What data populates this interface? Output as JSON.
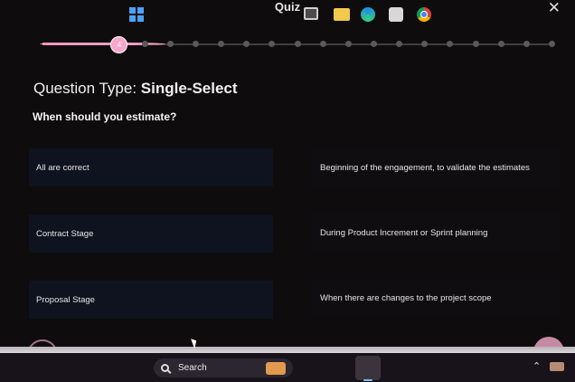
{
  "quiz": {
    "title": "Quiz",
    "close_symbol": "✕",
    "progress": {
      "current_step": 4,
      "total_steps": 21,
      "current_label": "4"
    },
    "question_type_label": "Question Type:",
    "question_type_value": "Single-Select",
    "question": "When should you estimate?",
    "options_left": [
      "All are correct",
      "Contract Stage",
      "Proposal Stage"
    ],
    "options_right": [
      "Beginning of the engagement, to validate the estimates",
      "During Product Increment or Sprint planning",
      "When there are changes to the project scope"
    ]
  },
  "taskbar": {
    "search_label": "Search",
    "icons": [
      "windows-start-icon",
      "search-icon",
      "task-view-icon",
      "file-explorer-icon",
      "edge-icon",
      "store-icon",
      "chrome-icon"
    ],
    "tray_arrow": "⌃"
  },
  "colors": {
    "accent": "#f39bc2",
    "background": "#0e0c0d"
  }
}
